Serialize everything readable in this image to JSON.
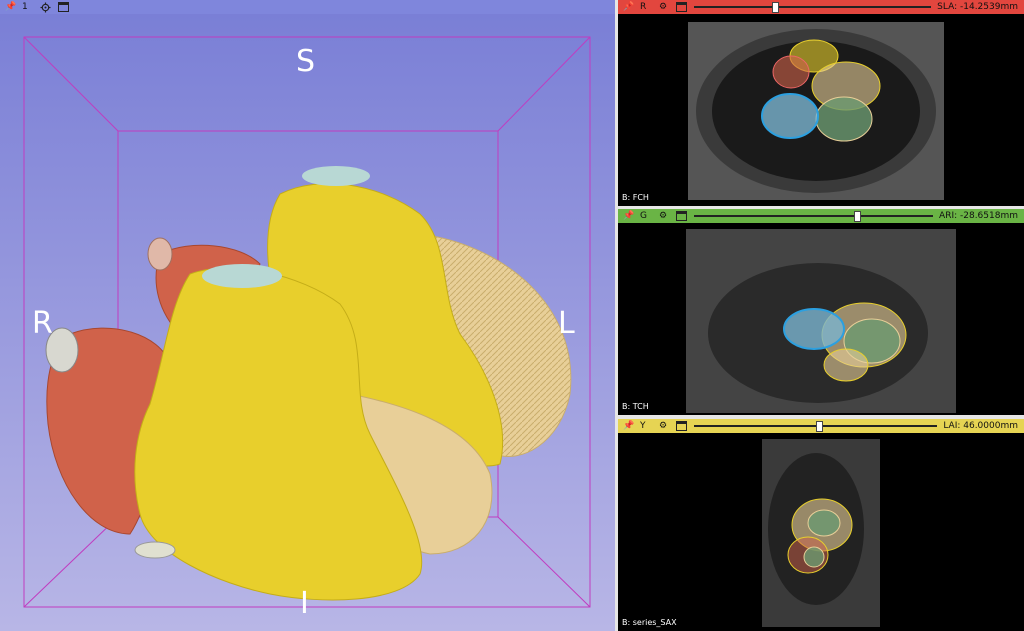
{
  "view3d": {
    "pin_icon": "pin-icon",
    "layout_number": "1",
    "gear_icon": "gear-icon",
    "window_icon": "window-icon",
    "orientation": {
      "superior": "S",
      "right": "R",
      "left": "L",
      "inferior": "I"
    }
  },
  "red_view": {
    "name": "R",
    "readout": "SLA: -14.2539mm",
    "slider_fraction": 0.33,
    "label": "B: FCH",
    "bar_color": "#e2463e"
  },
  "green_view": {
    "name": "G",
    "readout": "ARI: -28.6518mm",
    "slider_fraction": 0.67,
    "label": "B: TCH",
    "bar_color": "#6ab445"
  },
  "yellow_view": {
    "name": "Y",
    "readout": "LAI: 46.0000mm",
    "slider_fraction": 0.5,
    "label": "B: series_SAX",
    "bar_color": "#e6d453"
  },
  "colors": {
    "view3d_bg_top": "#7a7fd6",
    "view3d_bg_bottom": "#b8b6e6",
    "bbox": "#c03cc0",
    "ventricle": "#e8cf2c",
    "atrium_red": "#d0624a",
    "myocardium": "#e8cf98",
    "valve": "#b8d8d4"
  }
}
